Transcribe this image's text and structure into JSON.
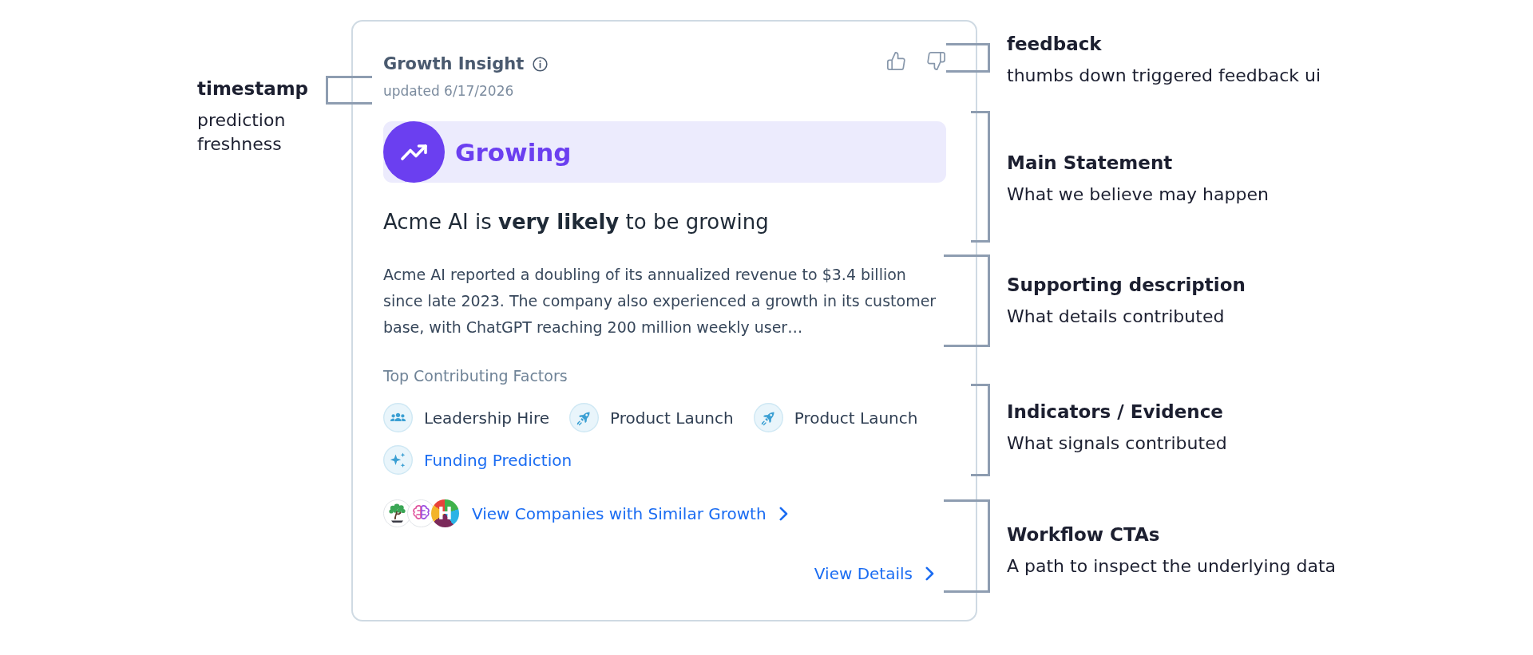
{
  "card": {
    "title": "Growth Insight",
    "updated": "updated 6/17/2026",
    "status": "Growing",
    "statement": "Acme AI is **very likely** to be growing",
    "description": "Acme AI reported a doubling of its annualized revenue to $3.4 billion since late 2023. The company also experienced a growth in its customer base, with ChatGPT reaching 200 million weekly user…",
    "factors_heading": "Top Contributing Factors",
    "factors": [
      {
        "kind": "hire",
        "label": "Leadership Hire"
      },
      {
        "kind": "launch",
        "label": "Product Launch"
      },
      {
        "kind": "launch",
        "label": "Product Launch"
      },
      {
        "kind": "prediction",
        "label": "Funding Prediction"
      }
    ],
    "similar_companies": {
      "logos": [
        {
          "kind": "tree"
        },
        {
          "kind": "brain"
        },
        {
          "kind": "letter",
          "text": "H"
        }
      ],
      "link": "View Companies with Similar Growth"
    },
    "details_link": "View Details"
  },
  "annotations": [
    {
      "title": "timestamp",
      "text": "prediction freshness"
    },
    {
      "title": "feedback",
      "text": "thumbs down triggered feedback ui"
    },
    {
      "title": "Main Statement",
      "text": "What we believe may happen"
    },
    {
      "title": "Supporting description",
      "text": "What details contributed"
    },
    {
      "title": "Indicators / Evidence",
      "text": "What signals contributed"
    },
    {
      "title": "Workflow CTAs",
      "text": "A path to inspect the underlying data"
    }
  ]
}
